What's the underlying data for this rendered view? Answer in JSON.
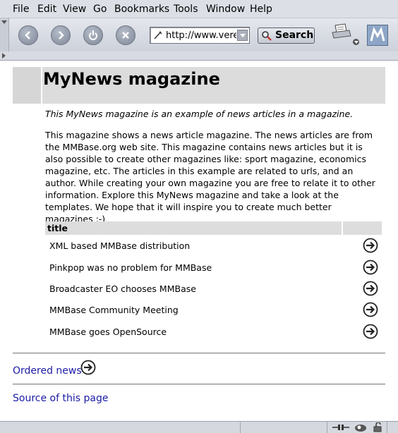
{
  "menu": [
    "File",
    "Edit",
    "View",
    "Go",
    "Bookmarks",
    "Tools",
    "Window",
    "Help"
  ],
  "toolbar": {
    "url": "http://www.verel",
    "search_label": "Search",
    "back_icon": "back-arrow-icon",
    "forward_icon": "forward-arrow-icon",
    "reload_icon": "reload-icon",
    "stop_icon": "stop-icon"
  },
  "page": {
    "title": "MyNews magazine",
    "intro": "This MyNews magazine is an example of news articles in a magazine.",
    "body": "This magazine shows a news article magazine. The news articles are from the MMBase.org web site. This magazine contains news articles but it is also possible to create other magazines like: sport magazine, economics magazine, etc. The articles in this example are related to urls, and an author. While creating your own magazine you are free to relate it to other information. Explore this MyNews magazine and take a look at the templates. We hope that it will inspire you to create much better magazines ;-)",
    "table_header": "title",
    "articles": [
      "XML based MMBase distribution",
      "Pinkpop was no problem for MMBase",
      "Broadcaster EO chooses MMBase",
      "MMBase Community Meeting",
      "MMBase goes OpenSource"
    ],
    "ordered_link": "Ordered news",
    "source_link": "Source of this page"
  },
  "colors": {
    "link": "#1a1aa6",
    "header_bg": "#dcdcdc",
    "chrome_bg": "#dcdfe6"
  }
}
